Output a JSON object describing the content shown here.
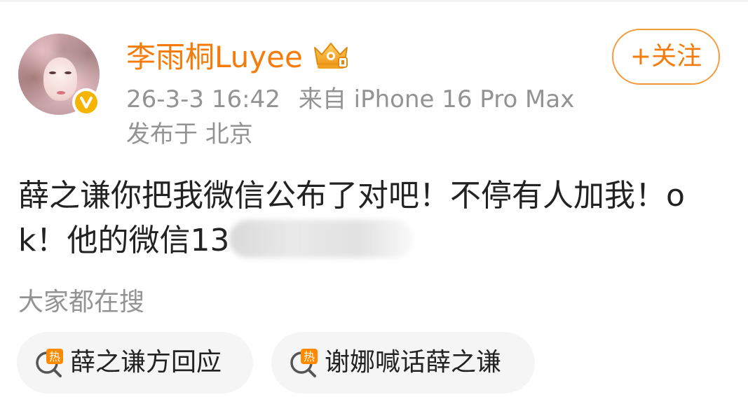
{
  "post": {
    "username": "李雨桐Luyee",
    "timestamp": "26-3-3 16:42",
    "source": "来自 iPhone 16 Pro Max",
    "location": "发布于 北京",
    "follow_label": "+关注",
    "text_visible": "薛之谦你把我微信公布了对吧！不停有人加我！ok！他的微信13"
  },
  "hot_search": {
    "title": "大家都在搜",
    "items": [
      {
        "label": "薛之谦方回应",
        "icon": "hot-search-icon"
      },
      {
        "label": "谢娜喊话薛之谦",
        "icon": "hot-search-icon"
      }
    ]
  },
  "colors": {
    "name": "#f57c0b",
    "meta": "#939393",
    "text": "#222222",
    "chip_bg": "#f5f5f5",
    "badge": "#f5b400"
  }
}
